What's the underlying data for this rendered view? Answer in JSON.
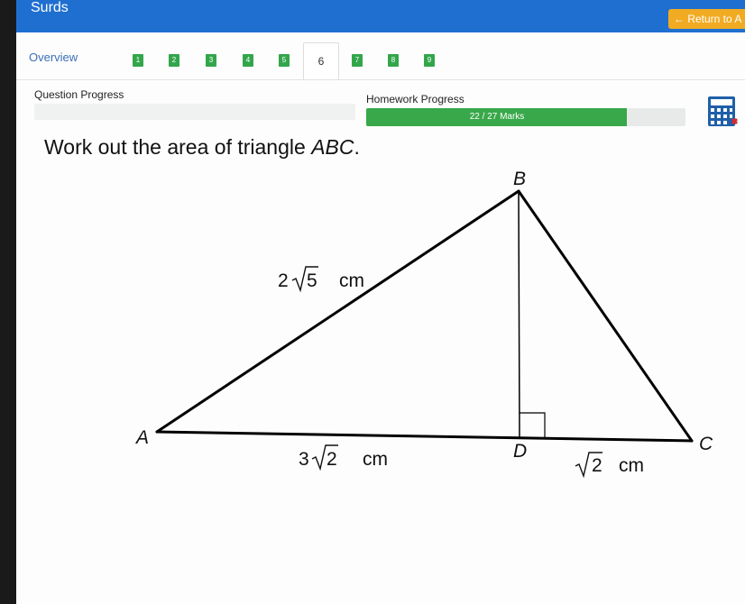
{
  "header": {
    "title": "Surds",
    "return_label": "← Return to A"
  },
  "tabs": {
    "overview_label": "Overview",
    "items": [
      "1",
      "2",
      "3",
      "4",
      "5",
      "6",
      "7",
      "8",
      "9"
    ],
    "active": "6"
  },
  "progress": {
    "question_label": "Question Progress",
    "homework_label": "Homework Progress",
    "homework_text": "22 / 27 Marks",
    "homework_fraction": 0.815
  },
  "question": {
    "prefix": "Work out the area of triangle ",
    "var": "ABC",
    "suffix": "."
  },
  "diagram": {
    "vertices": {
      "A": "A",
      "B": "B",
      "C": "C",
      "D": "D"
    },
    "labels": {
      "ab_coef": "2",
      "ab_rad": "5",
      "ab_unit": "cm",
      "ad_coef": "3",
      "ad_rad": "2",
      "ad_unit": "cm",
      "dc_rad": "2",
      "dc_unit": "cm"
    }
  },
  "colors": {
    "header": "#1f6fd0",
    "tab_green": "#33a64c",
    "progress_green": "#39a84a",
    "return_orange": "#f1ab22"
  },
  "icons": {
    "calculator": "calculator-icon"
  }
}
